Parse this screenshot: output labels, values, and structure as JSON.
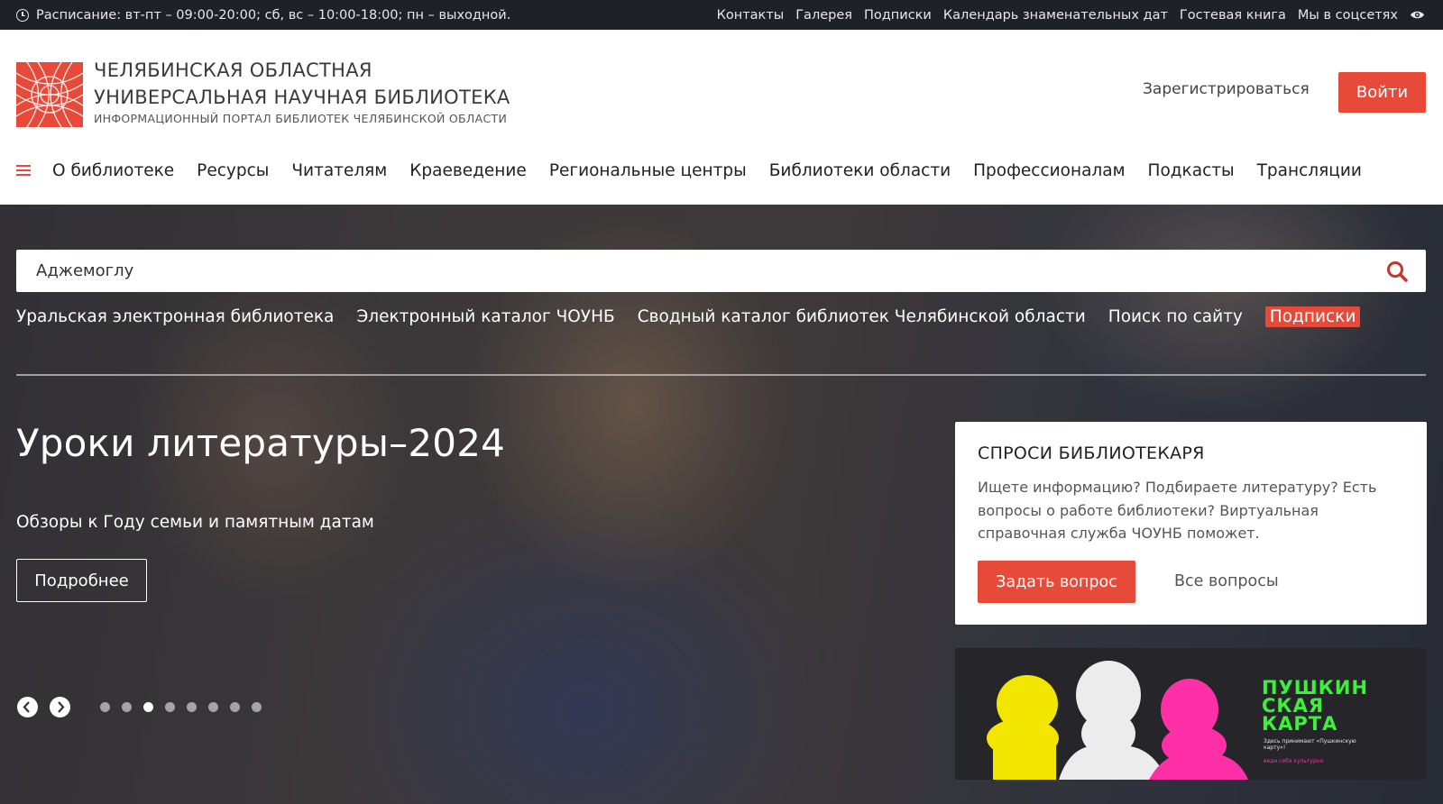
{
  "topbar": {
    "schedule": "Расписание: вт-пт – 09:00-20:00; сб, вс – 10:00-18:00; пн – выходной.",
    "links": [
      "Контакты",
      "Галерея",
      "Подписки",
      "Календарь знаменательных дат",
      "Гостевая книга",
      "Мы в соцсетях"
    ]
  },
  "header": {
    "line1": "ЧЕЛЯБИНСКАЯ ОБЛАСТНАЯ",
    "line2": "УНИВЕРСАЛЬНАЯ НАУЧНАЯ БИБЛИОТЕКА",
    "line3": "ИНФОРМАЦИОННЫЙ ПОРТАЛ БИБЛИОТЕК ЧЕЛЯБИНСКОЙ ОБЛАСТИ",
    "register": "Зарегистрироваться",
    "login": "Войти"
  },
  "nav": {
    "items": [
      "О библиотеке",
      "Ресурсы",
      "Читателям",
      "Краеведение",
      "Региональные центры",
      "Библиотеки области",
      "Профессионалам",
      "Подкасты",
      "Трансляции"
    ]
  },
  "search": {
    "value": "Аджемоглу"
  },
  "quick_links": [
    "Уральская электронная библиотека",
    "Электронный каталог ЧОУНБ",
    "Сводный каталог библиотек Челябинской области",
    "Поиск по сайту",
    "Подписки"
  ],
  "slide": {
    "title": "Уроки литературы–2024",
    "subtitle": "Обзоры к Году семьи и памятным датам",
    "button": "Подробнее",
    "dot_count": 8,
    "active_dot": 3
  },
  "ask": {
    "title": "СПРОСИ БИБЛИОТЕКАРЯ",
    "text": "Ищете информацию? Подбираете литературу? Есть вопросы о работе библиотеки? Виртуальная справочная служба ЧОУНБ поможет.",
    "button": "Задать вопрос",
    "all": "Все вопросы"
  },
  "pushkin": {
    "title1": "ПУШКИН",
    "title2": "СКАЯ",
    "title3": "КАРТА",
    "small1": "Здесь принимают «Пушкинскую карту»!",
    "small2": "веди себя культурно"
  },
  "colors": {
    "accent": "#e84a3a",
    "topbar": "#1f2128",
    "pushkin_green": "#3df03a",
    "pushkin_pink": "#ff2fa8",
    "pushkin_yellow": "#f2e600"
  },
  "icons": [
    "clock-icon",
    "eye-icon",
    "menu-icon",
    "search-icon",
    "arrow-left-icon",
    "arrow-right-icon"
  ]
}
